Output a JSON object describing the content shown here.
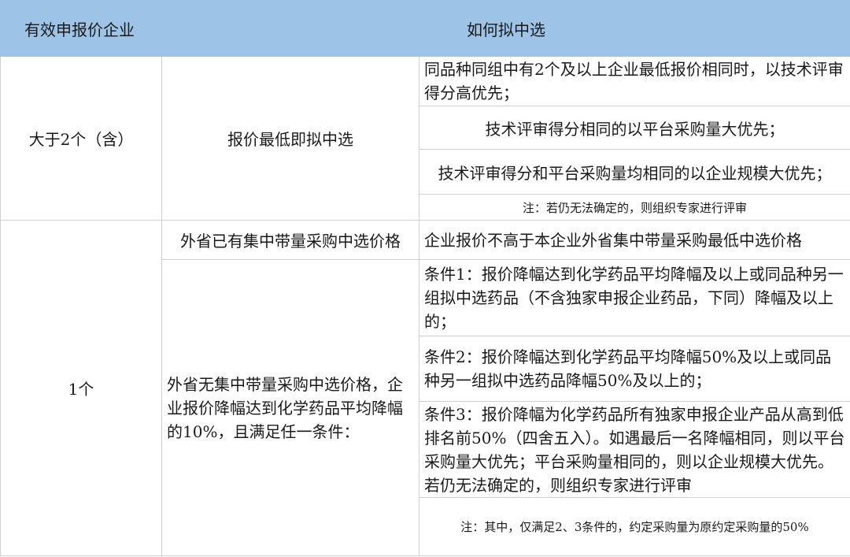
{
  "header": {
    "col1": "有效申报价企业",
    "col2": "如何拟中选"
  },
  "section1": {
    "count": "大于2个（含）",
    "method": "报价最低即拟中选",
    "rules": [
      "同品种同组中有2个及以上企业最低报价相同时，以技术评审得分高优先；",
      "技术评审得分相同的以平台采购量大优先；",
      "技术评审得分和平台采购量均相同的以企业规模大优先；"
    ],
    "note": "注：若仍无法确定的，则组织专家进行评审"
  },
  "section2": {
    "count": "1个",
    "case_a_method": "外省已有集中带量采购中选价格",
    "case_a_rule": "企业报价不高于本企业外省集中带量采购最低中选价格",
    "case_b_method": "外省无集中带量采购中选价格，企业报价降幅达到化学药品平均降幅的10%，且满足任一条件：",
    "conditions": [
      "条件1：报价降幅达到化学药品平均降幅及以上或同品种另一组拟中选药品（不含独家申报企业药品，下同）降幅及以上的；",
      "条件2：报价降幅达到化学药品平均降幅50%及以上或同品种另一组拟中选药品降幅50%及以上的；",
      "条件3：报价降幅为化学药品所有独家申报企业产品从高到低排名前50%（四舍五入）。如遇最后一名降幅相同，则以平台采购量大优先；平台采购量相同的，则以企业规模大优先。若仍无法确定的，则组织专家进行评审"
    ],
    "note": "注：其中，仅满足2、3条件的，约定采购量为原约定采购量的50%"
  }
}
